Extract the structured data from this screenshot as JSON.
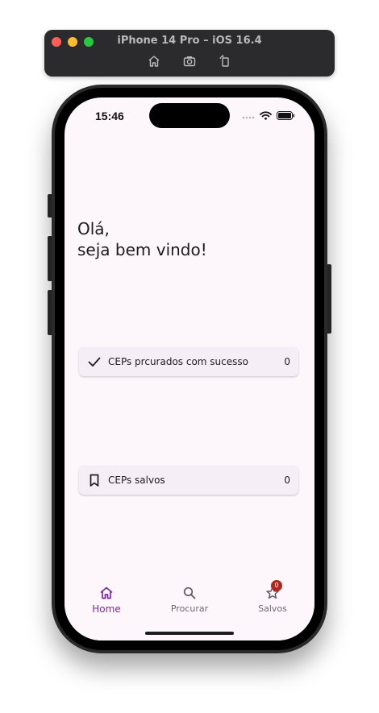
{
  "simulator": {
    "title": "iPhone 14 Pro – iOS 16.4",
    "tools": [
      "home-icon",
      "screenshot-icon",
      "rotate-icon"
    ]
  },
  "status_bar": {
    "time": "15:46"
  },
  "greeting": {
    "line1": "Olá,",
    "line2": "seja bem vindo!"
  },
  "cards": {
    "success": {
      "label": "CEPs prcurados com sucesso",
      "value": "0",
      "icon": "check-icon"
    },
    "saved": {
      "label": "CEPs salvos",
      "value": "0",
      "icon": "bookmark-icon"
    }
  },
  "nav": {
    "home": {
      "label": "Home",
      "icon": "home-icon",
      "active": true
    },
    "search": {
      "label": "Procurar",
      "icon": "search-icon"
    },
    "saved": {
      "label": "Salvos",
      "icon": "star-icon",
      "badge": "0"
    }
  },
  "colors": {
    "accent": "#7b2aa0",
    "screen_background": "#fdf7fb",
    "card_background": "#f6eef6",
    "badge": "#b3261e"
  }
}
